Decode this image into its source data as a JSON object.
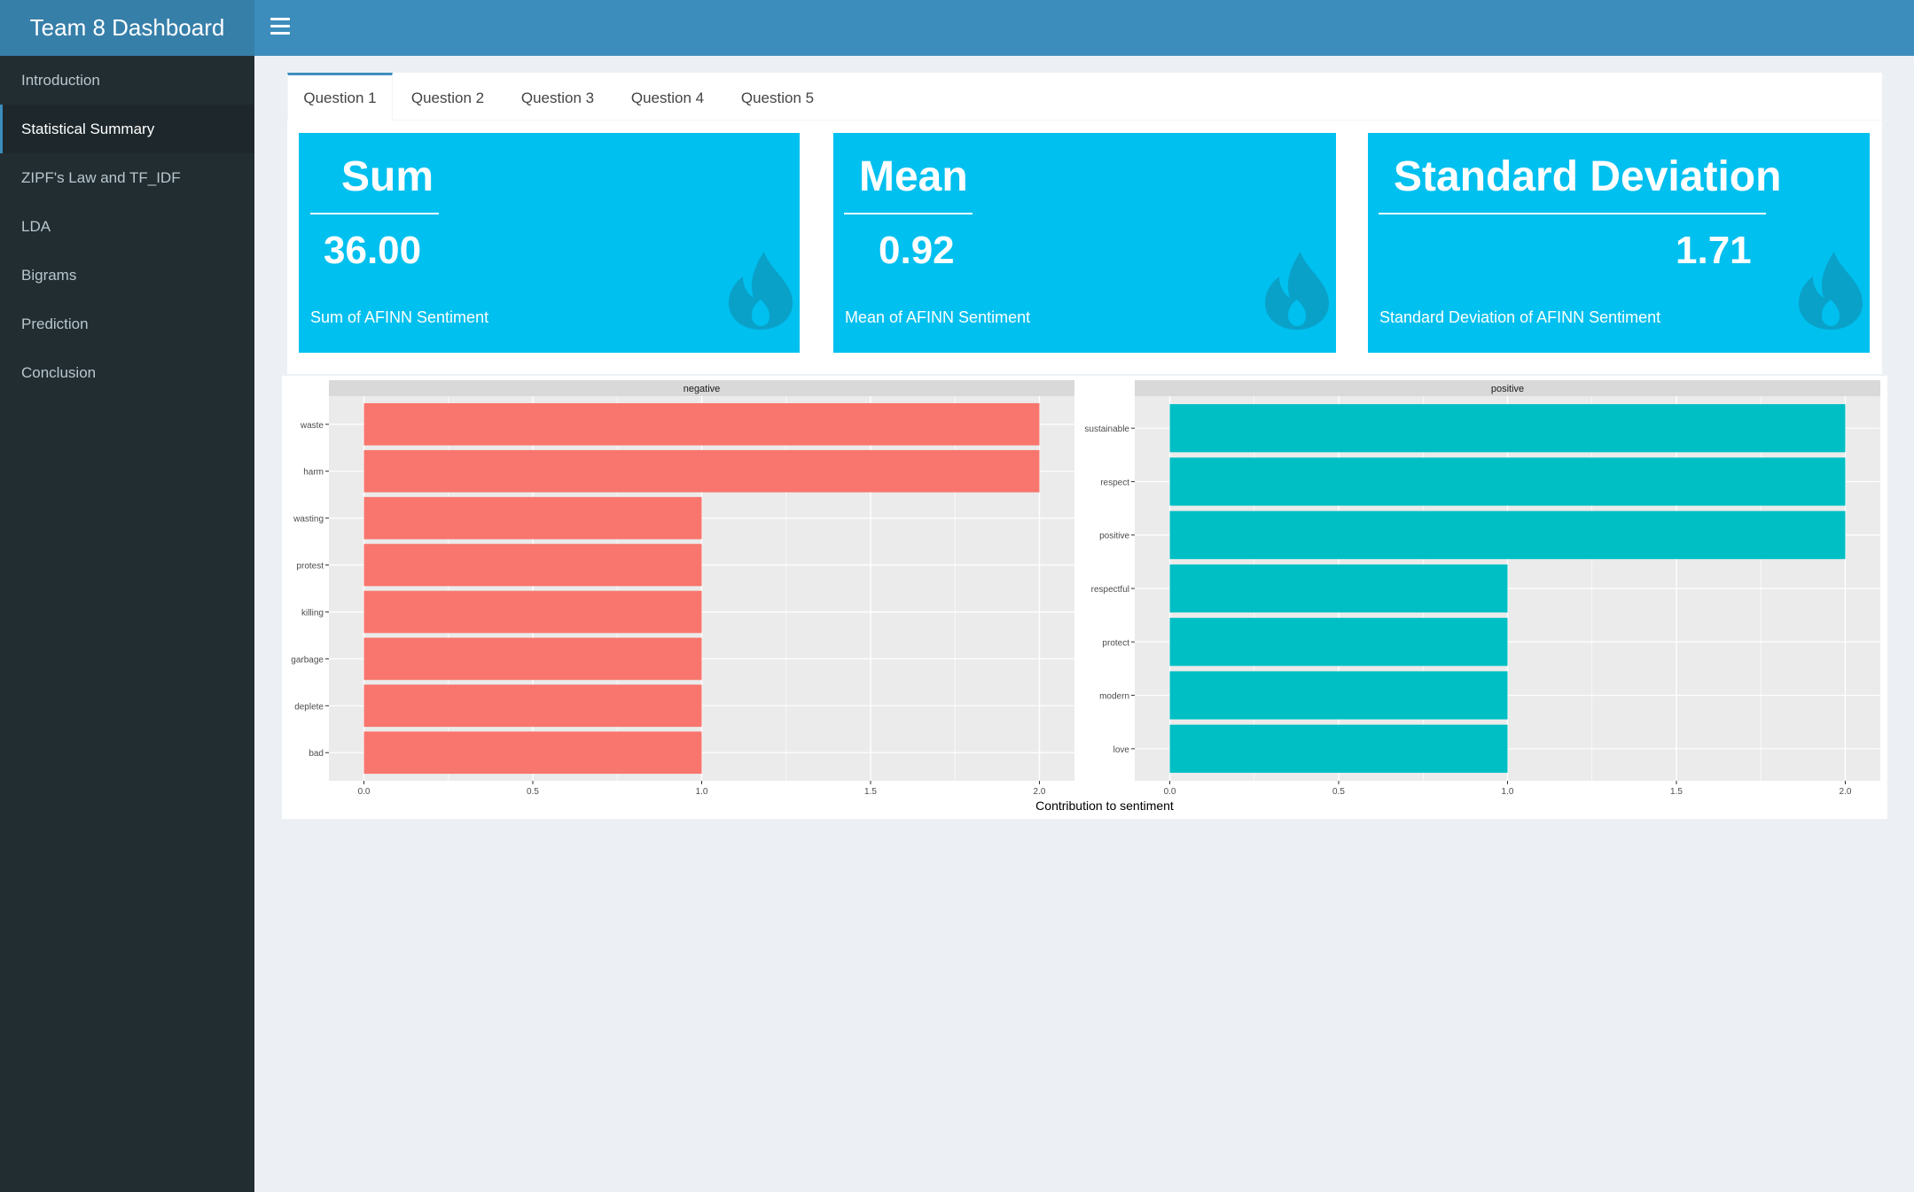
{
  "app": {
    "title": "Team 8 Dashboard"
  },
  "header": {
    "menu_icon": "hamburger-menu-icon"
  },
  "sidebar": {
    "items": [
      {
        "label": "Introduction",
        "active": false
      },
      {
        "label": "Statistical Summary",
        "active": true
      },
      {
        "label": "ZIPF's Law and TF_IDF",
        "active": false
      },
      {
        "label": "LDA",
        "active": false
      },
      {
        "label": "Bigrams",
        "active": false
      },
      {
        "label": "Prediction",
        "active": false
      },
      {
        "label": "Conclusion",
        "active": false
      }
    ]
  },
  "tabs": [
    {
      "label": "Question 1",
      "active": true
    },
    {
      "label": "Question 2",
      "active": false
    },
    {
      "label": "Question 3",
      "active": false
    },
    {
      "label": "Question 4",
      "active": false
    },
    {
      "label": "Question 5",
      "active": false
    }
  ],
  "value_boxes": [
    {
      "title": "Sum",
      "value": "36.00",
      "subtitle": "Sum of AFINN Sentiment",
      "icon": "fire-icon"
    },
    {
      "title": "Mean",
      "value": "0.92",
      "subtitle": "Mean of AFINN Sentiment",
      "icon": "fire-icon"
    },
    {
      "title": "Standard Deviation",
      "value": "1.71",
      "subtitle": "Standard Deviation of AFINN Sentiment",
      "icon": "fire-icon"
    }
  ],
  "colors": {
    "header": "#3c8dbc",
    "logo": "#367fa9",
    "sidebar": "#222d32",
    "value_box": "#00c0ef",
    "negative_bar": "#f8766d",
    "positive_bar": "#00bfc4",
    "panel_bg": "#ebebeb",
    "strip_bg": "#d9d9d9"
  },
  "chart_data": {
    "type": "bar",
    "orientation": "horizontal",
    "xlabel": "Contribution to sentiment",
    "xlim": [
      0,
      2.0
    ],
    "x_ticks": [
      "0.0",
      "0.5",
      "1.0",
      "1.5",
      "2.0"
    ],
    "grid": true,
    "facets": [
      {
        "name": "negative",
        "categories": [
          "waste",
          "harm",
          "wasting",
          "protest",
          "killing",
          "garbage",
          "deplete",
          "bad"
        ],
        "values": [
          2,
          2,
          1,
          1,
          1,
          1,
          1,
          1
        ]
      },
      {
        "name": "positive",
        "categories": [
          "sustainable",
          "respect",
          "positive",
          "respectful",
          "protect",
          "modern",
          "love"
        ],
        "values": [
          2,
          2,
          2,
          1,
          1,
          1,
          1
        ]
      }
    ]
  }
}
